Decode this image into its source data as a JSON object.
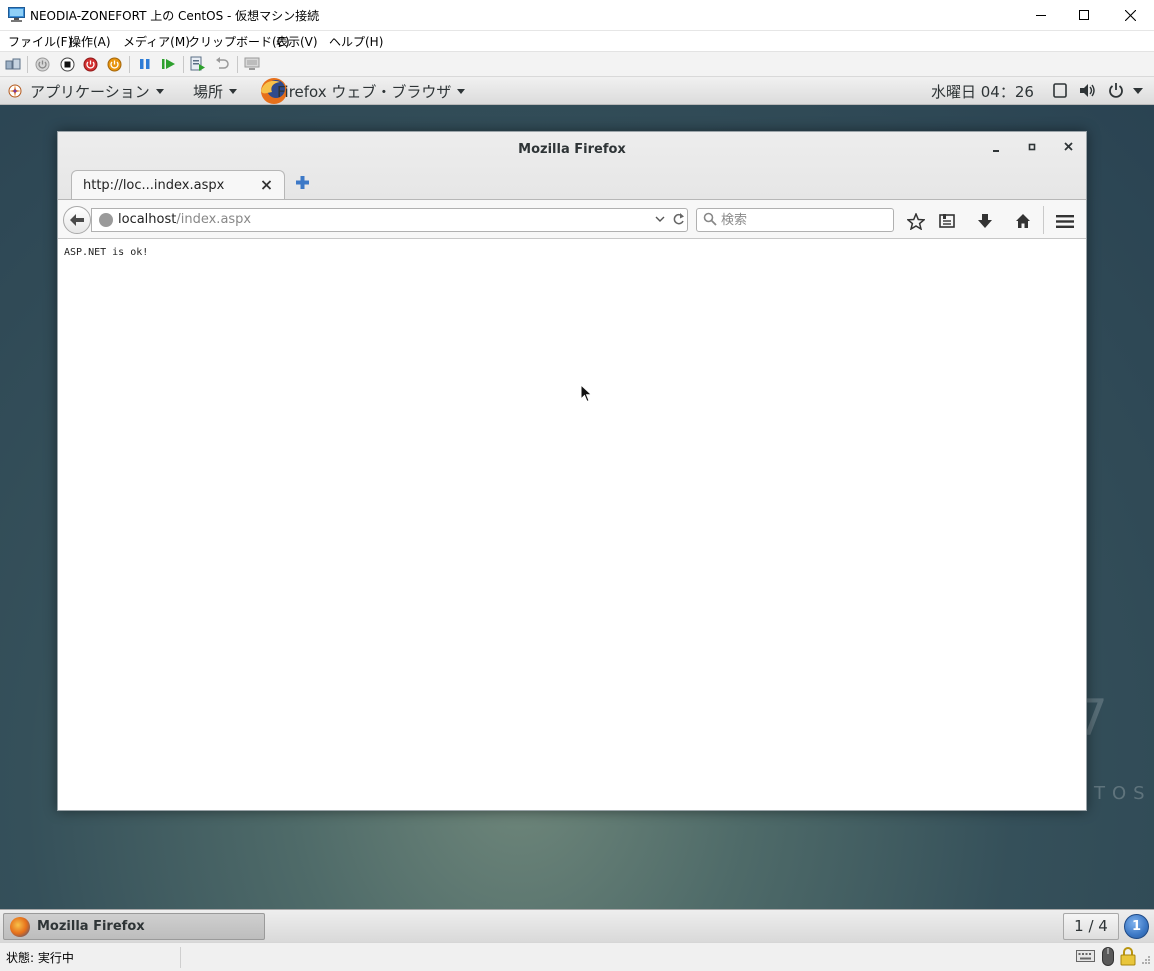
{
  "hyperv": {
    "title": "NEODIA-ZONEFORT 上の CentOS - 仮想マシン接続",
    "menu": {
      "file": "ファイル(F)",
      "action": "操作(A)",
      "media": "メディア(M)",
      "clipboard": "クリップボード(C)",
      "view": "表示(V)",
      "help": "ヘルプ(H)"
    },
    "status": "状態: 実行中"
  },
  "gnome_top": {
    "applications": "アプリケーション",
    "places": "場所",
    "active_app": "Firefox ウェブ・ブラウザ",
    "clock": "水曜日 04：26"
  },
  "firefox": {
    "window_title": "Mozilla Firefox",
    "tab_title": "http://loc...index.aspx",
    "url_host": "localhost",
    "url_path": "/index.aspx",
    "search_placeholder": "検索",
    "page_text": "ASP.NET is ok!"
  },
  "gnome_bottom": {
    "task_label": "Mozilla Firefox",
    "workspace": "1 / 4",
    "notification_count": "1"
  },
  "desktop": {
    "watermark_number": "7",
    "watermark_text": "TOS"
  },
  "colors": {
    "desktop_bg": "#35505a",
    "accent_blue": "#3d79c7",
    "power_red": "#d32f2f",
    "power_orange": "#e8950f",
    "play_green": "#2ea12e"
  }
}
